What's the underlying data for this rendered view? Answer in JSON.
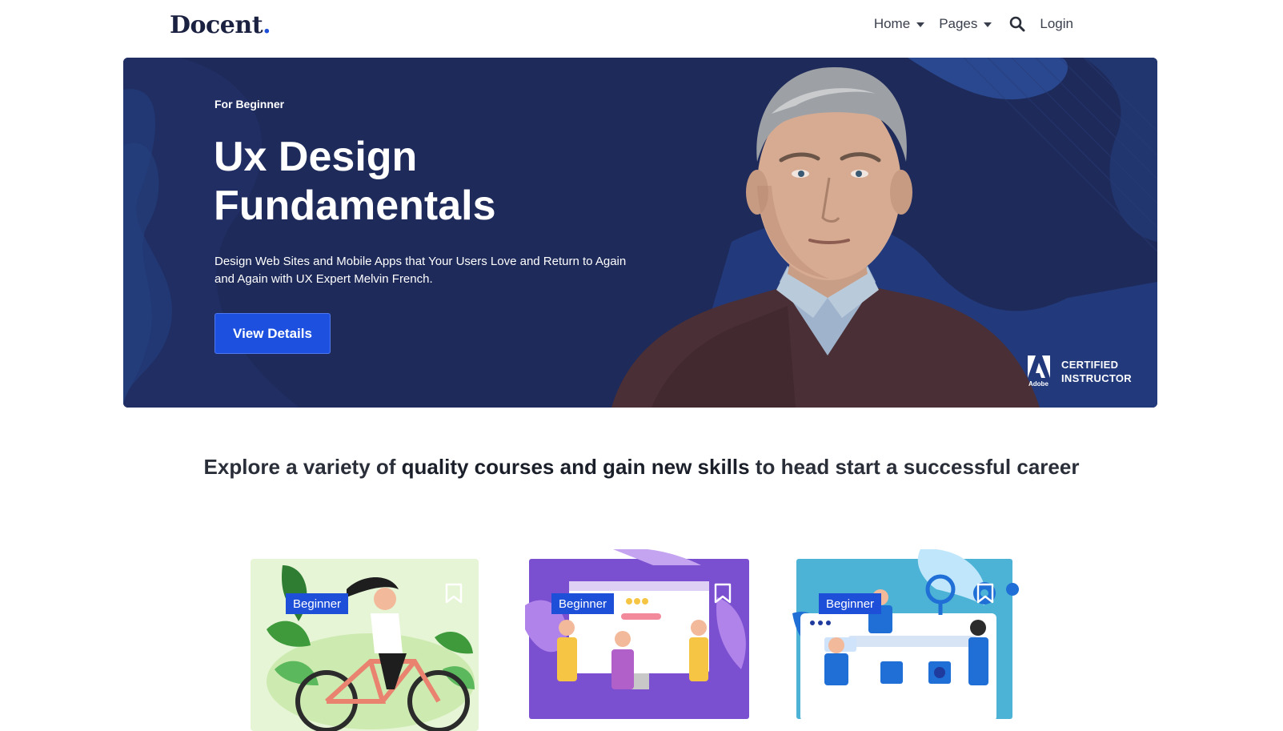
{
  "brand": {
    "name": "Docent",
    "dot": "."
  },
  "nav": {
    "home_label": "Home",
    "pages_label": "Pages",
    "login_label": "Login",
    "search_icon": "search-icon"
  },
  "hero": {
    "eyebrow": "For Beginner",
    "title": "Ux Design Fundamentals",
    "description": "Design Web Sites and Mobile Apps that Your Users Love and Return to Again and Again with UX Expert Melvin French.",
    "cta_label": "View Details",
    "badge_logo_caption": "Adobe",
    "badge_line1": "CERTIFIED",
    "badge_line2": "INSTRUCTOR"
  },
  "tagline": {
    "part1": "Explore a variety of ",
    "bold": "quality courses and gain new skills",
    "part2": " to head start a successful career"
  },
  "courses": [
    {
      "level": "Beginner",
      "art": "cyclist-illustration"
    },
    {
      "level": "Beginner",
      "art": "team-screen-illustration"
    },
    {
      "level": "Beginner",
      "art": "web-dashboard-illustration"
    }
  ],
  "colors": {
    "accent": "#1e50e0",
    "hero_bg": "#1e2a5a",
    "text_dark": "#1b2140"
  }
}
